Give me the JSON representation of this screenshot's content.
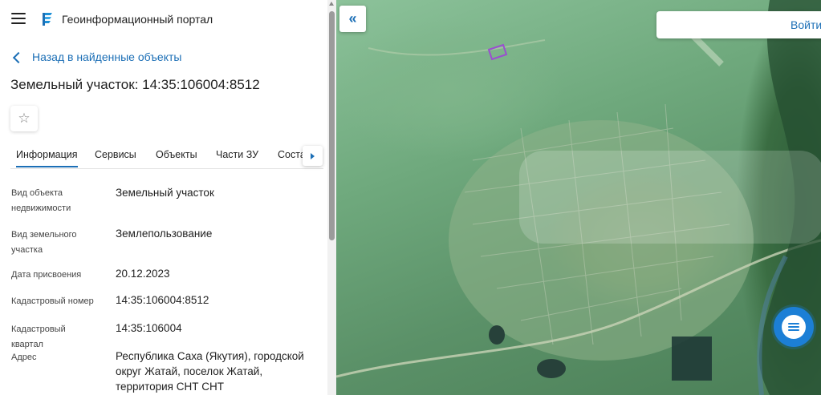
{
  "header": {
    "menu_icon": "hamburger-menu-icon",
    "logo_icon": "portal-logo-icon",
    "title": "Геоинформационный портал"
  },
  "nav": {
    "back_label": "Назад в найденные объекты",
    "back_icon": "chevron-left-icon"
  },
  "object": {
    "title": "Земельный участок: 14:35:106004:8512",
    "favorite_icon": "star-outline-icon"
  },
  "tabs": [
    {
      "label": "Информация",
      "active": true
    },
    {
      "label": "Сервисы",
      "active": false
    },
    {
      "label": "Объекты",
      "active": false
    },
    {
      "label": "Части ЗУ",
      "active": false
    },
    {
      "label": "Соста",
      "active": false
    }
  ],
  "tabs_scroll_icon": "chevron-right-icon",
  "fields": [
    {
      "label": "Вид объекта недвижимости",
      "value": "Земельный участок"
    },
    {
      "label": "Вид земельного участка",
      "value": "Землепользование"
    },
    {
      "label": "Дата присвоения",
      "value": "20.12.2023"
    },
    {
      "label": "Кадастровый номер",
      "value": "14:35:106004:8512"
    },
    {
      "label": "Кадастровый квартал",
      "value": "14:35:106004"
    },
    {
      "label": "Адрес",
      "value": "Республика Саха (Якутия), городской округ Жатай, поселок Жатай, территория СНТ СНТ"
    }
  ],
  "map": {
    "collapse_icon": "double-chevron-left-icon",
    "login_label": "Войти",
    "chat_icon": "chat-bubble-icon",
    "accent_color": "#1c6fb6"
  }
}
